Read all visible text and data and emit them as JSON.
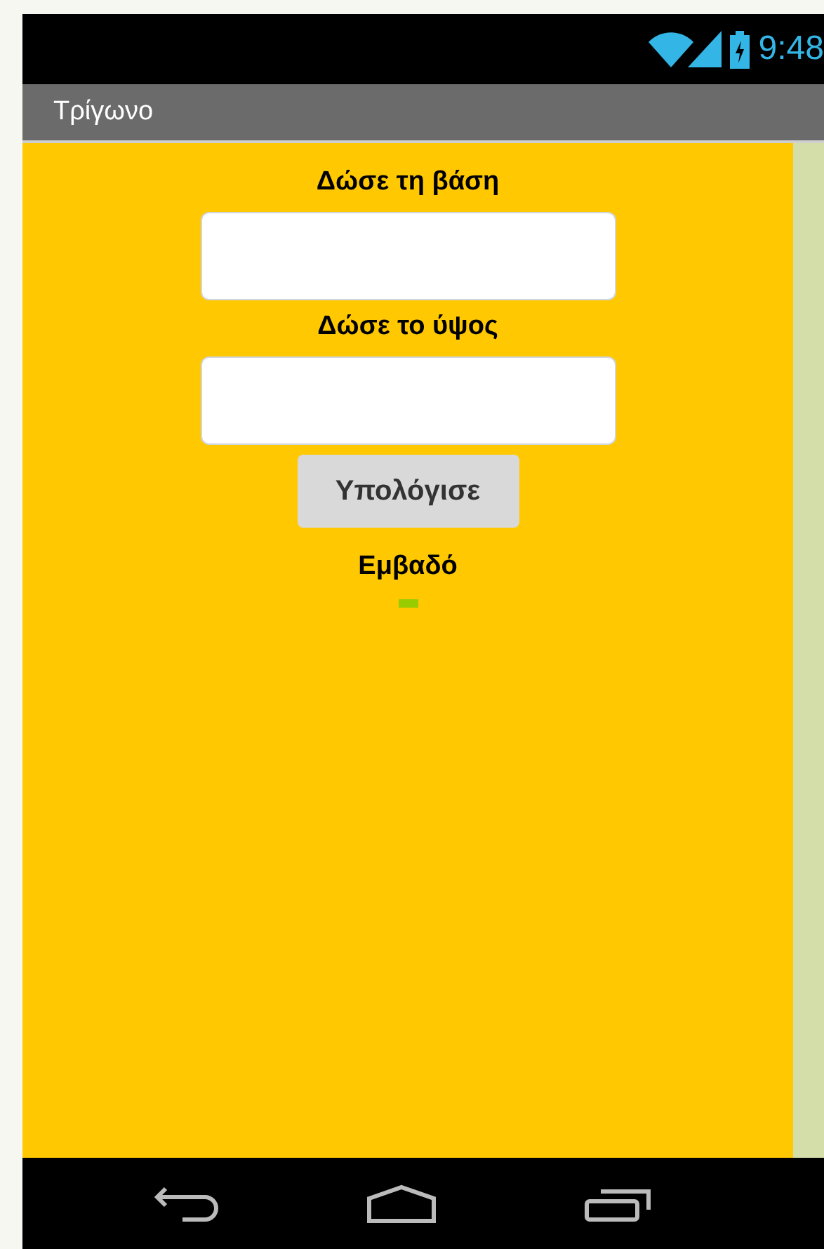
{
  "status_bar": {
    "time": "9:48"
  },
  "title_bar": {
    "title": "Τρίγωνο"
  },
  "form": {
    "items": [
      {
        "kind": "label",
        "text": "Δώσε τη βάση"
      },
      {
        "kind": "input"
      },
      {
        "kind": "label",
        "text": "Δώσε το ύψος"
      },
      {
        "kind": "input"
      },
      {
        "kind": "button",
        "text": "Υπολόγισε"
      },
      {
        "kind": "label",
        "text": "Εμβαδό"
      },
      {
        "kind": "result"
      }
    ]
  }
}
